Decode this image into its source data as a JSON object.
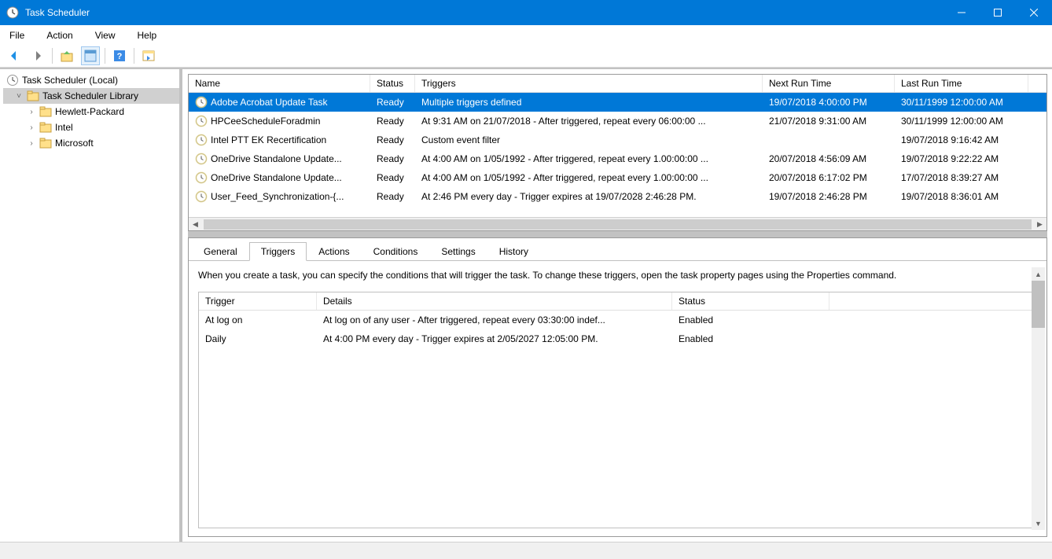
{
  "window": {
    "title": "Task Scheduler"
  },
  "menu": {
    "file": "File",
    "action": "Action",
    "view": "View",
    "help": "Help"
  },
  "tree": {
    "root": "Task Scheduler (Local)",
    "library": "Task Scheduler Library",
    "nodes": [
      "Hewlett-Packard",
      "Intel",
      "Microsoft"
    ]
  },
  "tasks": {
    "headers": {
      "name": "Name",
      "status": "Status",
      "triggers": "Triggers",
      "next": "Next Run Time",
      "last": "Last Run Time"
    },
    "rows": [
      {
        "name": "Adobe Acrobat Update Task",
        "status": "Ready",
        "triggers": "Multiple triggers defined",
        "next": "19/07/2018 4:00:00 PM",
        "last": "30/11/1999 12:00:00 AM",
        "selected": true
      },
      {
        "name": "HPCeeScheduleForadmin",
        "status": "Ready",
        "triggers": "At 9:31 AM on 21/07/2018 - After triggered, repeat every 06:00:00 ...",
        "next": "21/07/2018 9:31:00 AM",
        "last": "30/11/1999 12:00:00 AM"
      },
      {
        "name": "Intel PTT EK Recertification",
        "status": "Ready",
        "triggers": "Custom event filter",
        "next": "",
        "last": "19/07/2018 9:16:42 AM"
      },
      {
        "name": "OneDrive Standalone Update...",
        "status": "Ready",
        "triggers": "At 4:00 AM on 1/05/1992 - After triggered, repeat every 1.00:00:00 ...",
        "next": "20/07/2018 4:56:09 AM",
        "last": "19/07/2018 9:22:22 AM"
      },
      {
        "name": "OneDrive Standalone Update...",
        "status": "Ready",
        "triggers": "At 4:00 AM on 1/05/1992 - After triggered, repeat every 1.00:00:00 ...",
        "next": "20/07/2018 6:17:02 PM",
        "last": "17/07/2018 8:39:27 AM"
      },
      {
        "name": "User_Feed_Synchronization-{...",
        "status": "Ready",
        "triggers": "At 2:46 PM every day - Trigger expires at 19/07/2028 2:46:28 PM.",
        "next": "19/07/2018 2:46:28 PM",
        "last": "19/07/2018 8:36:01 AM"
      }
    ]
  },
  "tabs": {
    "general": "General",
    "triggers": "Triggers",
    "actions": "Actions",
    "conditions": "Conditions",
    "settings": "Settings",
    "history": "History"
  },
  "detail": {
    "description": "When you create a task, you can specify the conditions that will trigger the task.  To change these triggers, open the task property pages using the Properties command.",
    "headers": {
      "trigger": "Trigger",
      "details": "Details",
      "status": "Status"
    },
    "rows": [
      {
        "trigger": "At log on",
        "details": "At log on of any user - After triggered, repeat every 03:30:00 indef...",
        "status": "Enabled"
      },
      {
        "trigger": "Daily",
        "details": "At 4:00 PM every day - Trigger expires at 2/05/2027 12:05:00 PM.",
        "status": "Enabled"
      }
    ]
  }
}
